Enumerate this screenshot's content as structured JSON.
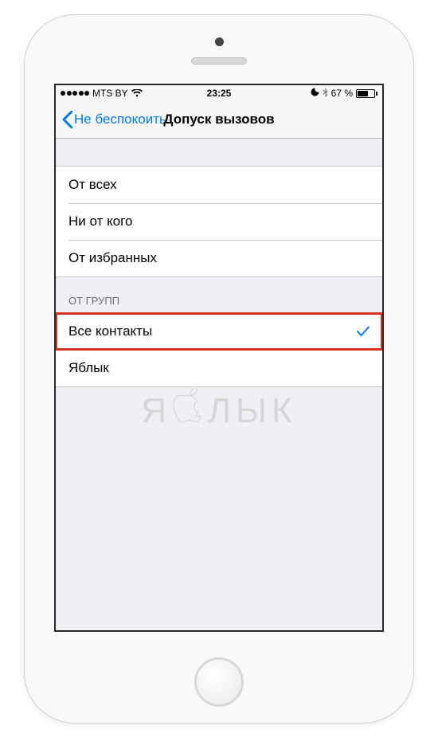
{
  "status_bar": {
    "carrier": "MTS BY",
    "time": "23:25",
    "battery_percent": "67 %"
  },
  "nav": {
    "back_label": "Не беспокоить",
    "title": "Допуск вызовов"
  },
  "section1": {
    "items": [
      {
        "label": "От всех"
      },
      {
        "label": "Ни от кого"
      },
      {
        "label": "От избранных"
      }
    ]
  },
  "section2": {
    "header": "ОТ ГРУПП",
    "items": [
      {
        "label": "Все контакты",
        "selected": true,
        "highlighted": true
      },
      {
        "label": "Яблык"
      }
    ]
  },
  "watermark": {
    "left": "Я",
    "right": "ЛЫК"
  }
}
